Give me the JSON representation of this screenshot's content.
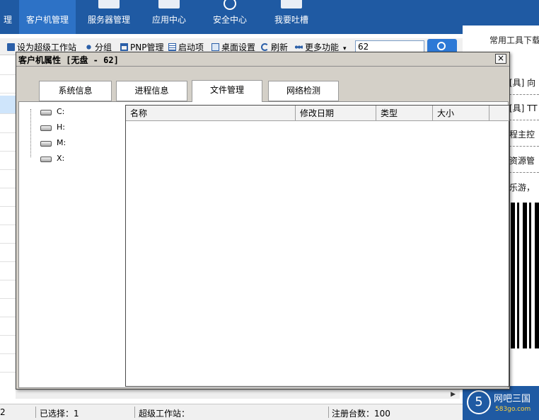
{
  "nav": {
    "items": [
      {
        "label": "理",
        "active": false
      },
      {
        "label": "客户机管理",
        "active": true
      },
      {
        "label": "服务器管理",
        "active": false
      },
      {
        "label": "应用中心",
        "active": false
      },
      {
        "label": "安全中心",
        "active": false
      },
      {
        "label": "我要吐槽",
        "active": false
      }
    ]
  },
  "toolbar": {
    "set_superstation": "设为超级工作站",
    "group": "分组",
    "pnp": "PNP管理",
    "startup": "启动项",
    "desktop": "桌面设置",
    "refresh": "刷新",
    "more": "更多功能",
    "search_value": "62"
  },
  "right_panel": {
    "title": "常用工具下载",
    "lines": [
      "[具] 向",
      "[具] TT",
      "程主控",
      "资源管",
      "乐游，"
    ]
  },
  "dialog": {
    "title": "客户机属性 [无盘 - 62]",
    "close_label": "×",
    "tabs": [
      {
        "label": "系统信息",
        "active": false
      },
      {
        "label": "进程信息",
        "active": false
      },
      {
        "label": "文件管理",
        "active": true
      },
      {
        "label": "网络检测",
        "active": false
      }
    ],
    "drives": [
      {
        "label": "C:"
      },
      {
        "label": "H:"
      },
      {
        "label": "M:"
      },
      {
        "label": "X:"
      }
    ],
    "columns": {
      "name": "名称",
      "modified": "修改日期",
      "type": "类型",
      "size": "大小"
    }
  },
  "statusbar": {
    "left": "2",
    "selected": "已选择：1",
    "superstation": "超级工作站：",
    "registered": "注册台数：100"
  },
  "footer": {
    "logo_glyph": "5",
    "brand": "网吧三国",
    "url": "583go.com"
  },
  "colors": {
    "nav_bg": "#1f5aa3",
    "nav_active": "#2d72c6",
    "dialog_bg": "#d4d0c8",
    "selection": "#cfe5fb"
  }
}
